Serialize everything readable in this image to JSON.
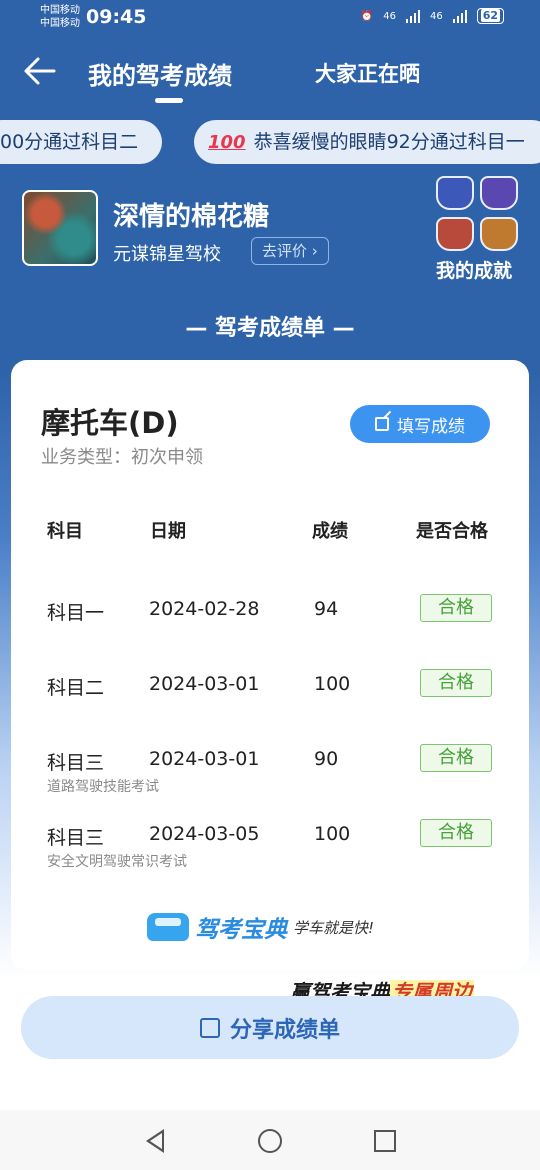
{
  "status_bar": {
    "carrier_1": "中国移动",
    "carrier_2": "中国移动",
    "time": "09:45",
    "signal_1": "46",
    "signal_2": "46",
    "battery": "62"
  },
  "header": {
    "tab_active": "我的驾考成绩",
    "tab_other": "大家正在晒"
  },
  "ticker": {
    "item_1": "00分通过科目二",
    "item_2_icon": "100",
    "item_2": "恭喜缓慢的眼睛92分通过科目一"
  },
  "profile": {
    "name": "深情的棉花糖",
    "school": "元谋锦星驾校",
    "rate_button": "去评价 ›",
    "achievements_label": "我的成就"
  },
  "section_title": "— 驾考成绩单 —",
  "card": {
    "vehicle": "摩托车(D)",
    "business_type": "业务类型：初次申领",
    "fill_button": "填写成绩",
    "columns": [
      "科目",
      "日期",
      "成绩",
      "是否合格"
    ],
    "rows": [
      {
        "subject": "科目一",
        "date": "2024-02-28",
        "score": "94",
        "result": "合格",
        "note": ""
      },
      {
        "subject": "科目二",
        "date": "2024-03-01",
        "score": "100",
        "result": "合格",
        "note": ""
      },
      {
        "subject": "科目三",
        "date": "2024-03-01",
        "score": "90",
        "result": "合格",
        "note": "道路驾驶技能考试"
      },
      {
        "subject": "科目三",
        "date": "2024-03-05",
        "score": "100",
        "result": "合格",
        "note": "安全文明驾驶常识考试"
      }
    ],
    "brand_name": "驾考宝典",
    "brand_slogan": "学车就是快!"
  },
  "promo": {
    "prefix": "赢驾考宝典",
    "highlight": "专属周边"
  },
  "share_button": "分享成绩单",
  "colors": {
    "header_blue": "#2f63a9",
    "button_blue": "#3d93f0",
    "pass_green": "#46a13a"
  }
}
